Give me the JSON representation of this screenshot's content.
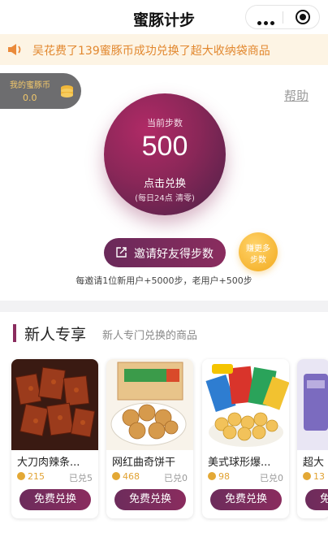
{
  "app": {
    "title": "蜜豚计步"
  },
  "notice": {
    "text": "吴花费了139蜜豚币成功兑换了超大收纳袋商品"
  },
  "wallet": {
    "label": "我的蜜豚币",
    "value": "0.0"
  },
  "help": {
    "label": "帮助"
  },
  "steps": {
    "label": "当前步数",
    "value": "500",
    "action": "点击兑换",
    "note": "(每日24点 清零)"
  },
  "invite": {
    "button_label": "邀请好友得步数",
    "more_line1": "赚更多",
    "more_line2": "步数",
    "rule": "每邀请1位新用户+5000步，老用户+500步"
  },
  "newbie": {
    "title": "新人专享",
    "subtitle": "新人专门兑换的商品",
    "items": [
      {
        "name": "大刀肉辣条...",
        "price": "215",
        "sold": "已兑5",
        "button": "免费兑换"
      },
      {
        "name": "网红曲奇饼干",
        "price": "468",
        "sold": "已兑0",
        "button": "免费兑换"
      },
      {
        "name": "美式球形爆...",
        "price": "98",
        "sold": "已兑0",
        "button": "免费兑换"
      },
      {
        "name": "超大",
        "price": "13",
        "sold": "",
        "button": "免费兑换"
      }
    ]
  },
  "colors": {
    "accent": "#8a2c5e",
    "gold": "#f2aa1e",
    "notice_text": "#e2882f"
  }
}
